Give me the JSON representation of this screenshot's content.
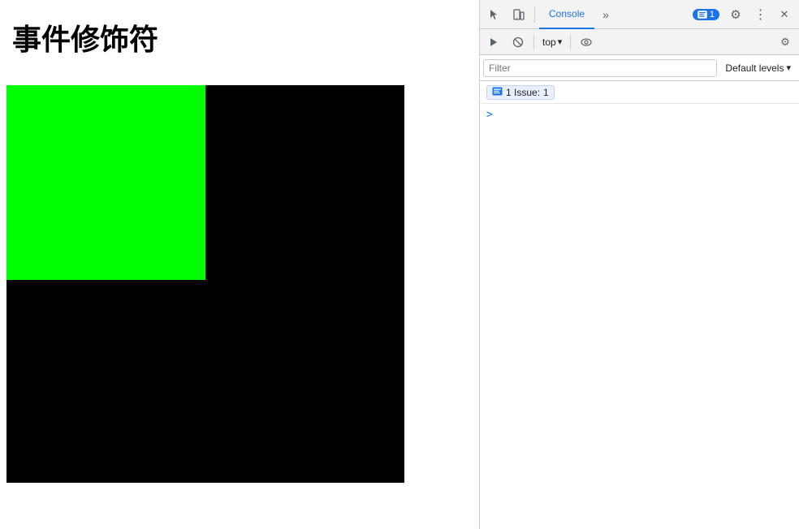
{
  "page": {
    "title": "事件修饰符"
  },
  "devtools": {
    "tabs": {
      "console_label": "Console",
      "more_label": "»"
    },
    "toolbar2": {
      "context_label": "top",
      "chevron": "▾"
    },
    "filter": {
      "placeholder": "Filter",
      "levels_label": "Default levels",
      "levels_chevron": "▾"
    },
    "issues": {
      "label": "1 Issue:",
      "count": "1"
    },
    "console_arrow": ">"
  },
  "icons": {
    "cursor": "⬚",
    "pointer": "↖",
    "rectangle": "▭",
    "ban": "⊘",
    "eye": "◉",
    "gear": "⚙",
    "more": "⋮",
    "close": "✕",
    "play": "▶",
    "settings_small": "⚙",
    "chevron_down": "▾"
  }
}
